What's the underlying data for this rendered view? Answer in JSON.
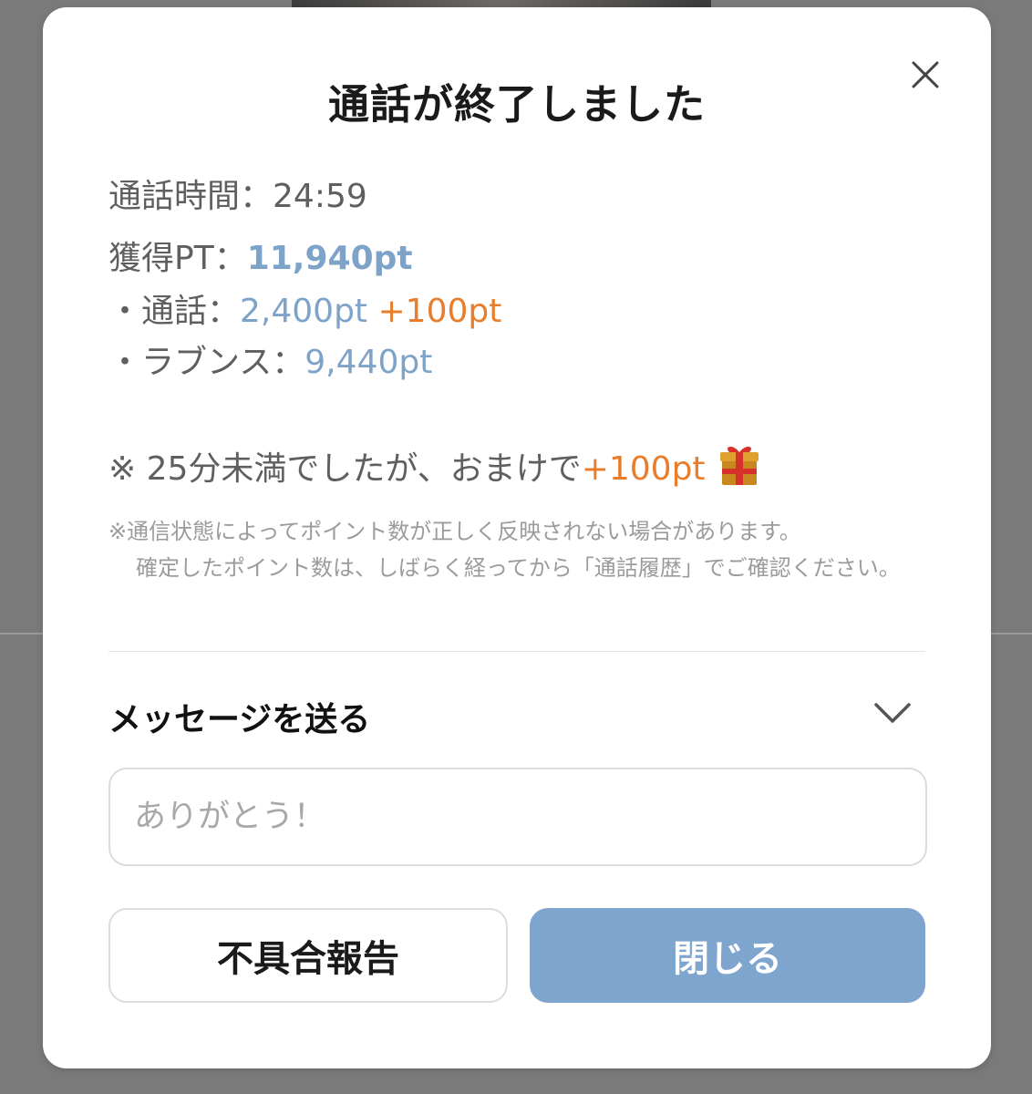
{
  "dialog": {
    "title": "通話が終了しました",
    "close_icon": "close-icon",
    "call_time_label": "通話時間：",
    "call_time_value": "24:59",
    "points_label": "獲得PT：",
    "points_total": "11,940pt",
    "breakdown": [
      {
        "label": "・通話：",
        "value": "2,400pt",
        "bonus": "+100pt"
      },
      {
        "label": "・ラブンス：",
        "value": "9,440pt"
      }
    ],
    "bonus_note_prefix": "※ 25分未満でしたが、おまけで",
    "bonus_note_value": "+100pt",
    "bonus_icon": "gift-icon",
    "notice_line1": "※通信状態によってポイント数が正しく反映されない場合があります。",
    "notice_line2": "確定したポイント数は、しばらく経ってから「通話履歴」でご確認ください。"
  },
  "message": {
    "section_title": "メッセージを送る",
    "toggle_icon": "chevron-down-icon",
    "placeholder": "ありがとう！",
    "value": ""
  },
  "buttons": {
    "report_label": "不具合報告",
    "close_label": "閉じる"
  },
  "colors": {
    "accent_blue": "#7ea3c9",
    "bonus_orange": "#e87d2b",
    "primary_button": "#7ea5cd",
    "overlay": "#7a7a7a"
  }
}
